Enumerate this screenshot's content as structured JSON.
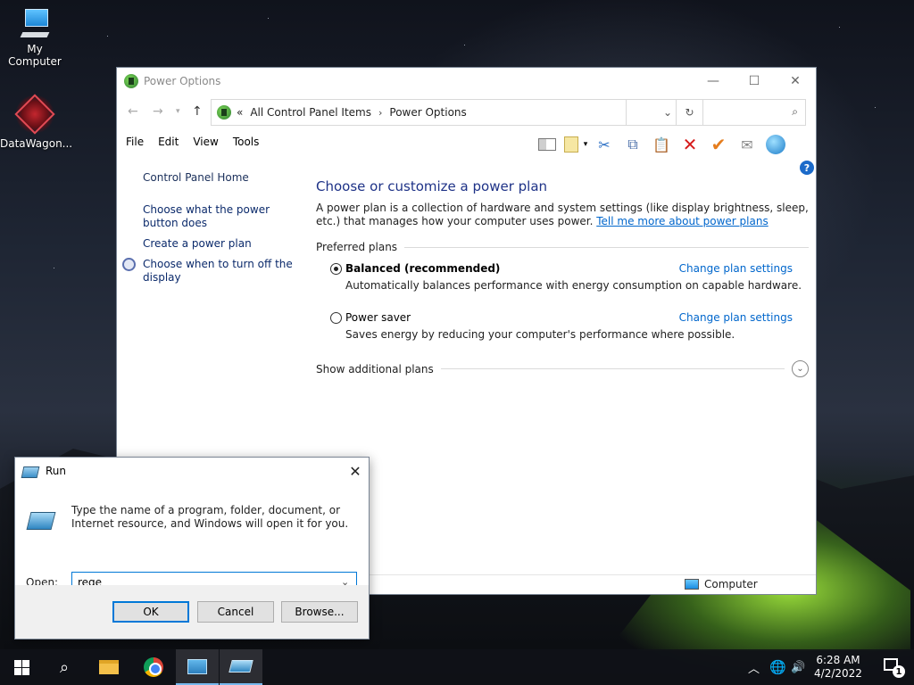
{
  "desktop": {
    "icons": [
      {
        "label": "My Computer",
        "icon": "computer-icon"
      },
      {
        "label": "DataWagon...",
        "icon": "datawagon-shortcut-icon"
      }
    ]
  },
  "power_options": {
    "title": "Power Options",
    "address": {
      "overflow": "«",
      "crumbs": [
        "All Control Panel Items",
        "Power Options"
      ]
    },
    "search_placeholder": "",
    "menu": [
      "File",
      "Edit",
      "View",
      "Tools"
    ],
    "toolbar": [
      "preview-pane-icon",
      "properties-icon",
      "cut-icon",
      "copy-icon",
      "paste-icon",
      "delete-icon",
      "check-icon",
      "mail-icon",
      "globe-icon"
    ],
    "left_links": {
      "home": "Control Panel Home",
      "power_button": "Choose what the power button does",
      "create_plan": "Create a power plan",
      "turn_off_display": "Choose when to turn off the display"
    },
    "heading": "Choose or customize a power plan",
    "description": "A power plan is a collection of hardware and system settings (like display brightness, sleep, etc.) that manages how your computer uses power.",
    "learn_more": "Tell me more about power plans",
    "preferred_label": "Preferred plans",
    "plans": [
      {
        "name": "Balanced (recommended)",
        "desc": "Automatically balances performance with energy consumption on capable hardware.",
        "change": "Change plan settings",
        "selected": true
      },
      {
        "name": "Power saver",
        "desc": "Saves energy by reducing your computer's performance where possible.",
        "change": "Change plan settings",
        "selected": false
      }
    ],
    "additional_plans": "Show additional plans",
    "status_computer": "Computer"
  },
  "run_dialog": {
    "title": "Run",
    "description": "Type the name of a program, folder, document, or Internet resource, and Windows will open it for you.",
    "open_label": "Open:",
    "open_value": "rege",
    "buttons": {
      "ok": "OK",
      "cancel": "Cancel",
      "browse": "Browse..."
    }
  },
  "taskbar": {
    "clock_time": "6:28 AM",
    "clock_date": "4/2/2022",
    "notification_count": "1"
  }
}
